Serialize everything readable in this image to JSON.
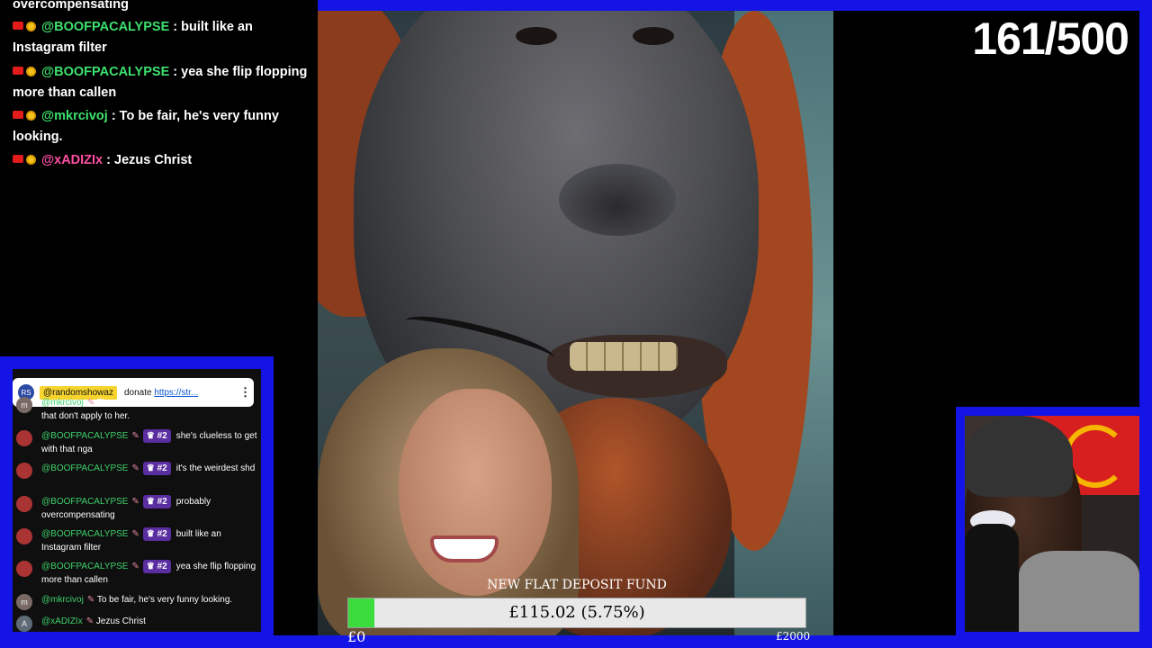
{
  "stream_chat": {
    "lines": [
      {
        "user": "",
        "text": "overcompensating"
      },
      {
        "user": "@BOOFPACALYPSE",
        "text": ": built like an Instagram filter"
      },
      {
        "user": "@BOOFPACALYPSE",
        "text": ": yea she flip flopping more than callen"
      },
      {
        "user": "@mkrcivoj",
        "text": ": To be fair, he's very funny looking."
      },
      {
        "user": "@xADIZIx",
        "text": ": Jezus Christ"
      }
    ]
  },
  "counter": "161/500",
  "fund": {
    "title": "NEW FLAT DEPOSIT FUND",
    "amount_text": "£115.02 (5.75%)",
    "progress": 0.0575,
    "min_label": "£0",
    "max_label": "£2000",
    "fill_color": "#3ddc3d"
  },
  "yt_chat": {
    "pinned": {
      "avatar": "RS",
      "name": "@randomshowaz",
      "text": "donate",
      "link": "https://str...",
      "menu_icon": "more-vert-icon"
    },
    "messages": [
      {
        "avatar": "m",
        "author": "@mkrcivoj",
        "rank": "",
        "text": "The religious ones aren't sexual, but that don't apply to her."
      },
      {
        "avatar": "",
        "author": "@BOOFPACALYPSE",
        "rank": "#2",
        "text": "she's clueless to get with that nga"
      },
      {
        "avatar": "",
        "author": "@BOOFPACALYPSE",
        "rank": "#2",
        "text": "it's the weirdest shd"
      },
      {
        "avatar": "",
        "author": "@BOOFPACALYPSE",
        "rank": "#2",
        "text": "probably overcompensating"
      },
      {
        "avatar": "",
        "author": "@BOOFPACALYPSE",
        "rank": "#2",
        "text": "built like an Instagram filter"
      },
      {
        "avatar": "",
        "author": "@BOOFPACALYPSE",
        "rank": "#2",
        "text": "yea she flip flopping more than callen"
      },
      {
        "avatar": "m",
        "author": "@mkrcivoj",
        "rank": "",
        "text": "To be fair, he's very funny looking."
      },
      {
        "avatar": "A",
        "author": "@xADIZIx",
        "rank": "",
        "text": "Jezus Christ"
      }
    ]
  },
  "colors": {
    "frame_blue": "#1414e6",
    "username_green": "#3de06e",
    "username_pink": "#ff4fa3"
  }
}
